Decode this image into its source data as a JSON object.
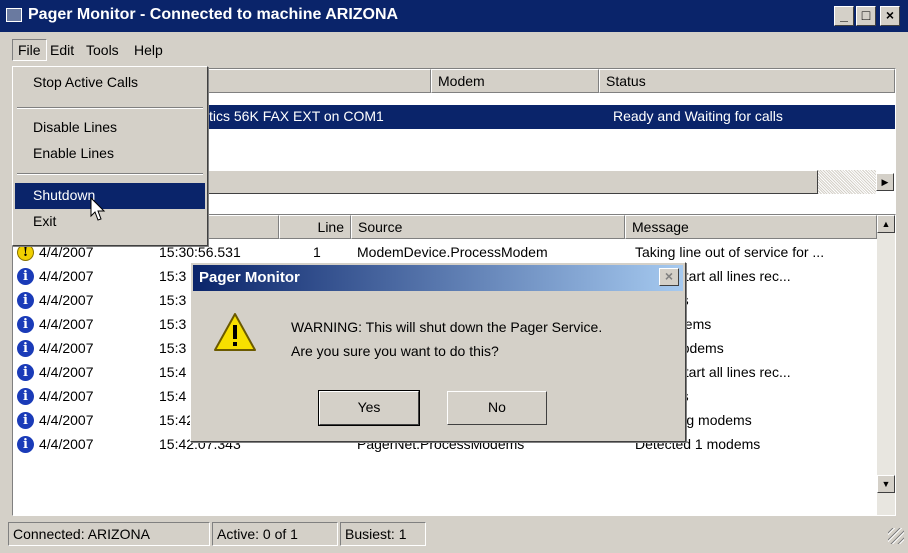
{
  "window": {
    "title": "Pager Monitor - Connected to machine ARIZONA"
  },
  "caption_buttons": {
    "minimize": "_",
    "maximize": "□",
    "close": "×"
  },
  "menubar": [
    "File",
    "Edit",
    "Tools",
    "Help"
  ],
  "file_menu": {
    "items": [
      "Stop Active Calls",
      "Disable Lines",
      "Enable Lines",
      "Shutdown",
      "Exit"
    ],
    "highlighted": "Shutdown"
  },
  "lines_list": {
    "columns": [
      "Modem",
      "Status"
    ],
    "row": {
      "modem": "tics 56K FAX EXT on COM1",
      "status": "Ready and Waiting for calls"
    }
  },
  "log_list": {
    "columns": {
      "line": "Line",
      "source": "Source",
      "message": "Message"
    },
    "rows": [
      {
        "icon": "warning-icon",
        "date": "4/4/2007",
        "time": "15:30:56.531",
        "line": "1",
        "source": "ModemDevice.ProcessModem",
        "message": "Taking line out of service for ..."
      },
      {
        "icon": "info-icon",
        "date": "4/4/2007",
        "time": "15:3",
        "line": "",
        "source": "",
        "message": "st to restart all lines rec..."
      },
      {
        "icon": "info-icon",
        "date": "4/4/2007",
        "time": "15:3",
        "line": "",
        "source": "",
        "message": "modems"
      },
      {
        "icon": "info-icon",
        "date": "4/4/2007",
        "time": "15:3",
        "line": "",
        "source": "",
        "message": "ing modems"
      },
      {
        "icon": "info-icon",
        "date": "4/4/2007",
        "time": "15:3",
        "line": "",
        "source": "",
        "message": "ted 1  modems"
      },
      {
        "icon": "info-icon",
        "date": "4/4/2007",
        "time": "15:4",
        "line": "",
        "source": "",
        "message": "st to restart all lines rec..."
      },
      {
        "icon": "info-icon",
        "date": "4/4/2007",
        "time": "15:4",
        "line": "",
        "source": "",
        "message": "modems"
      },
      {
        "icon": "info-icon",
        "date": "4/4/2007",
        "time": "15:42:05.362",
        "line": "",
        "source": "PagerNet.ProcessModems",
        "message": "Detecting modems"
      },
      {
        "icon": "info-icon",
        "date": "4/4/2007",
        "time": "15:42:07.343",
        "line": "",
        "source": "PagerNet.ProcessModems",
        "message": "Detected 1  modems"
      }
    ]
  },
  "statusbar": {
    "connected": "Connected: ARIZONA",
    "active": "Active: 0 of 1",
    "busiest": "Busiest: 1"
  },
  "dialog": {
    "title": "Pager Monitor",
    "line1": "WARNING: This will shut down the Pager Service.",
    "line2": "Are you sure you want to do this?",
    "yes": "Yes",
    "no": "No"
  },
  "colors": {
    "titlebar": "#0a246a",
    "selection": "#0a246a",
    "face": "#d4d0c8"
  }
}
